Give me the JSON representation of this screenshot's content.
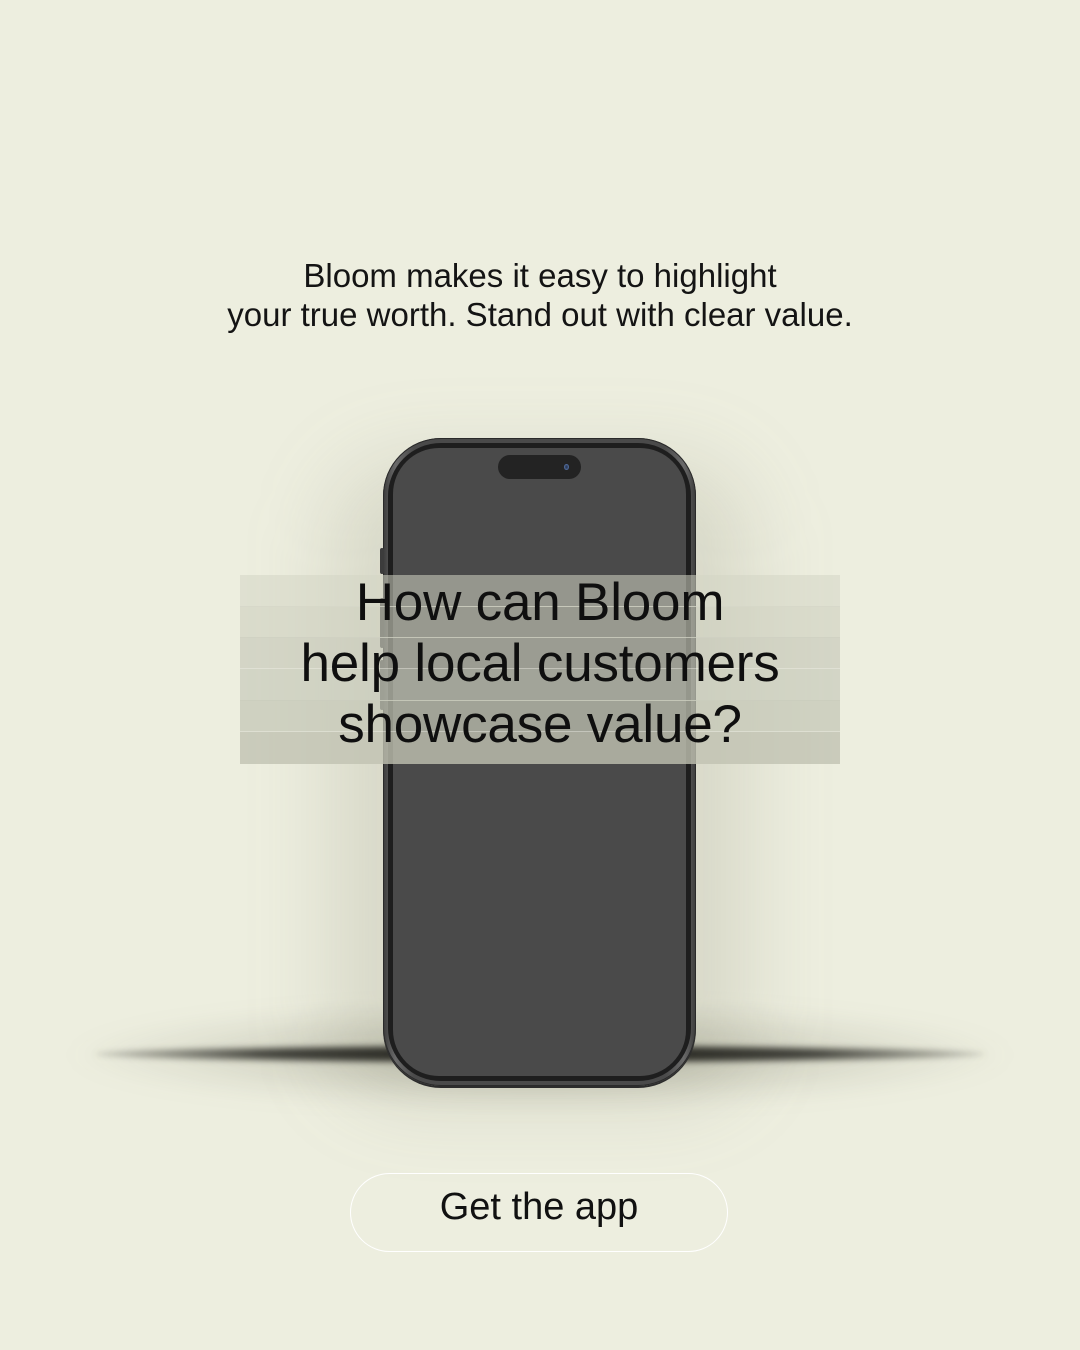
{
  "tagline": {
    "line1": "Bloom makes it easy to highlight",
    "line2": "your true worth. Stand out with clear value."
  },
  "headline": {
    "line1": "How can Bloom",
    "line2": "help local customers",
    "line3": "showcase value?"
  },
  "cta": {
    "label": "Get the app"
  },
  "colors": {
    "background": "#edeedf",
    "phone_screen": "#4a4a4a",
    "text": "#111111",
    "cta_border": "#ffffff"
  }
}
